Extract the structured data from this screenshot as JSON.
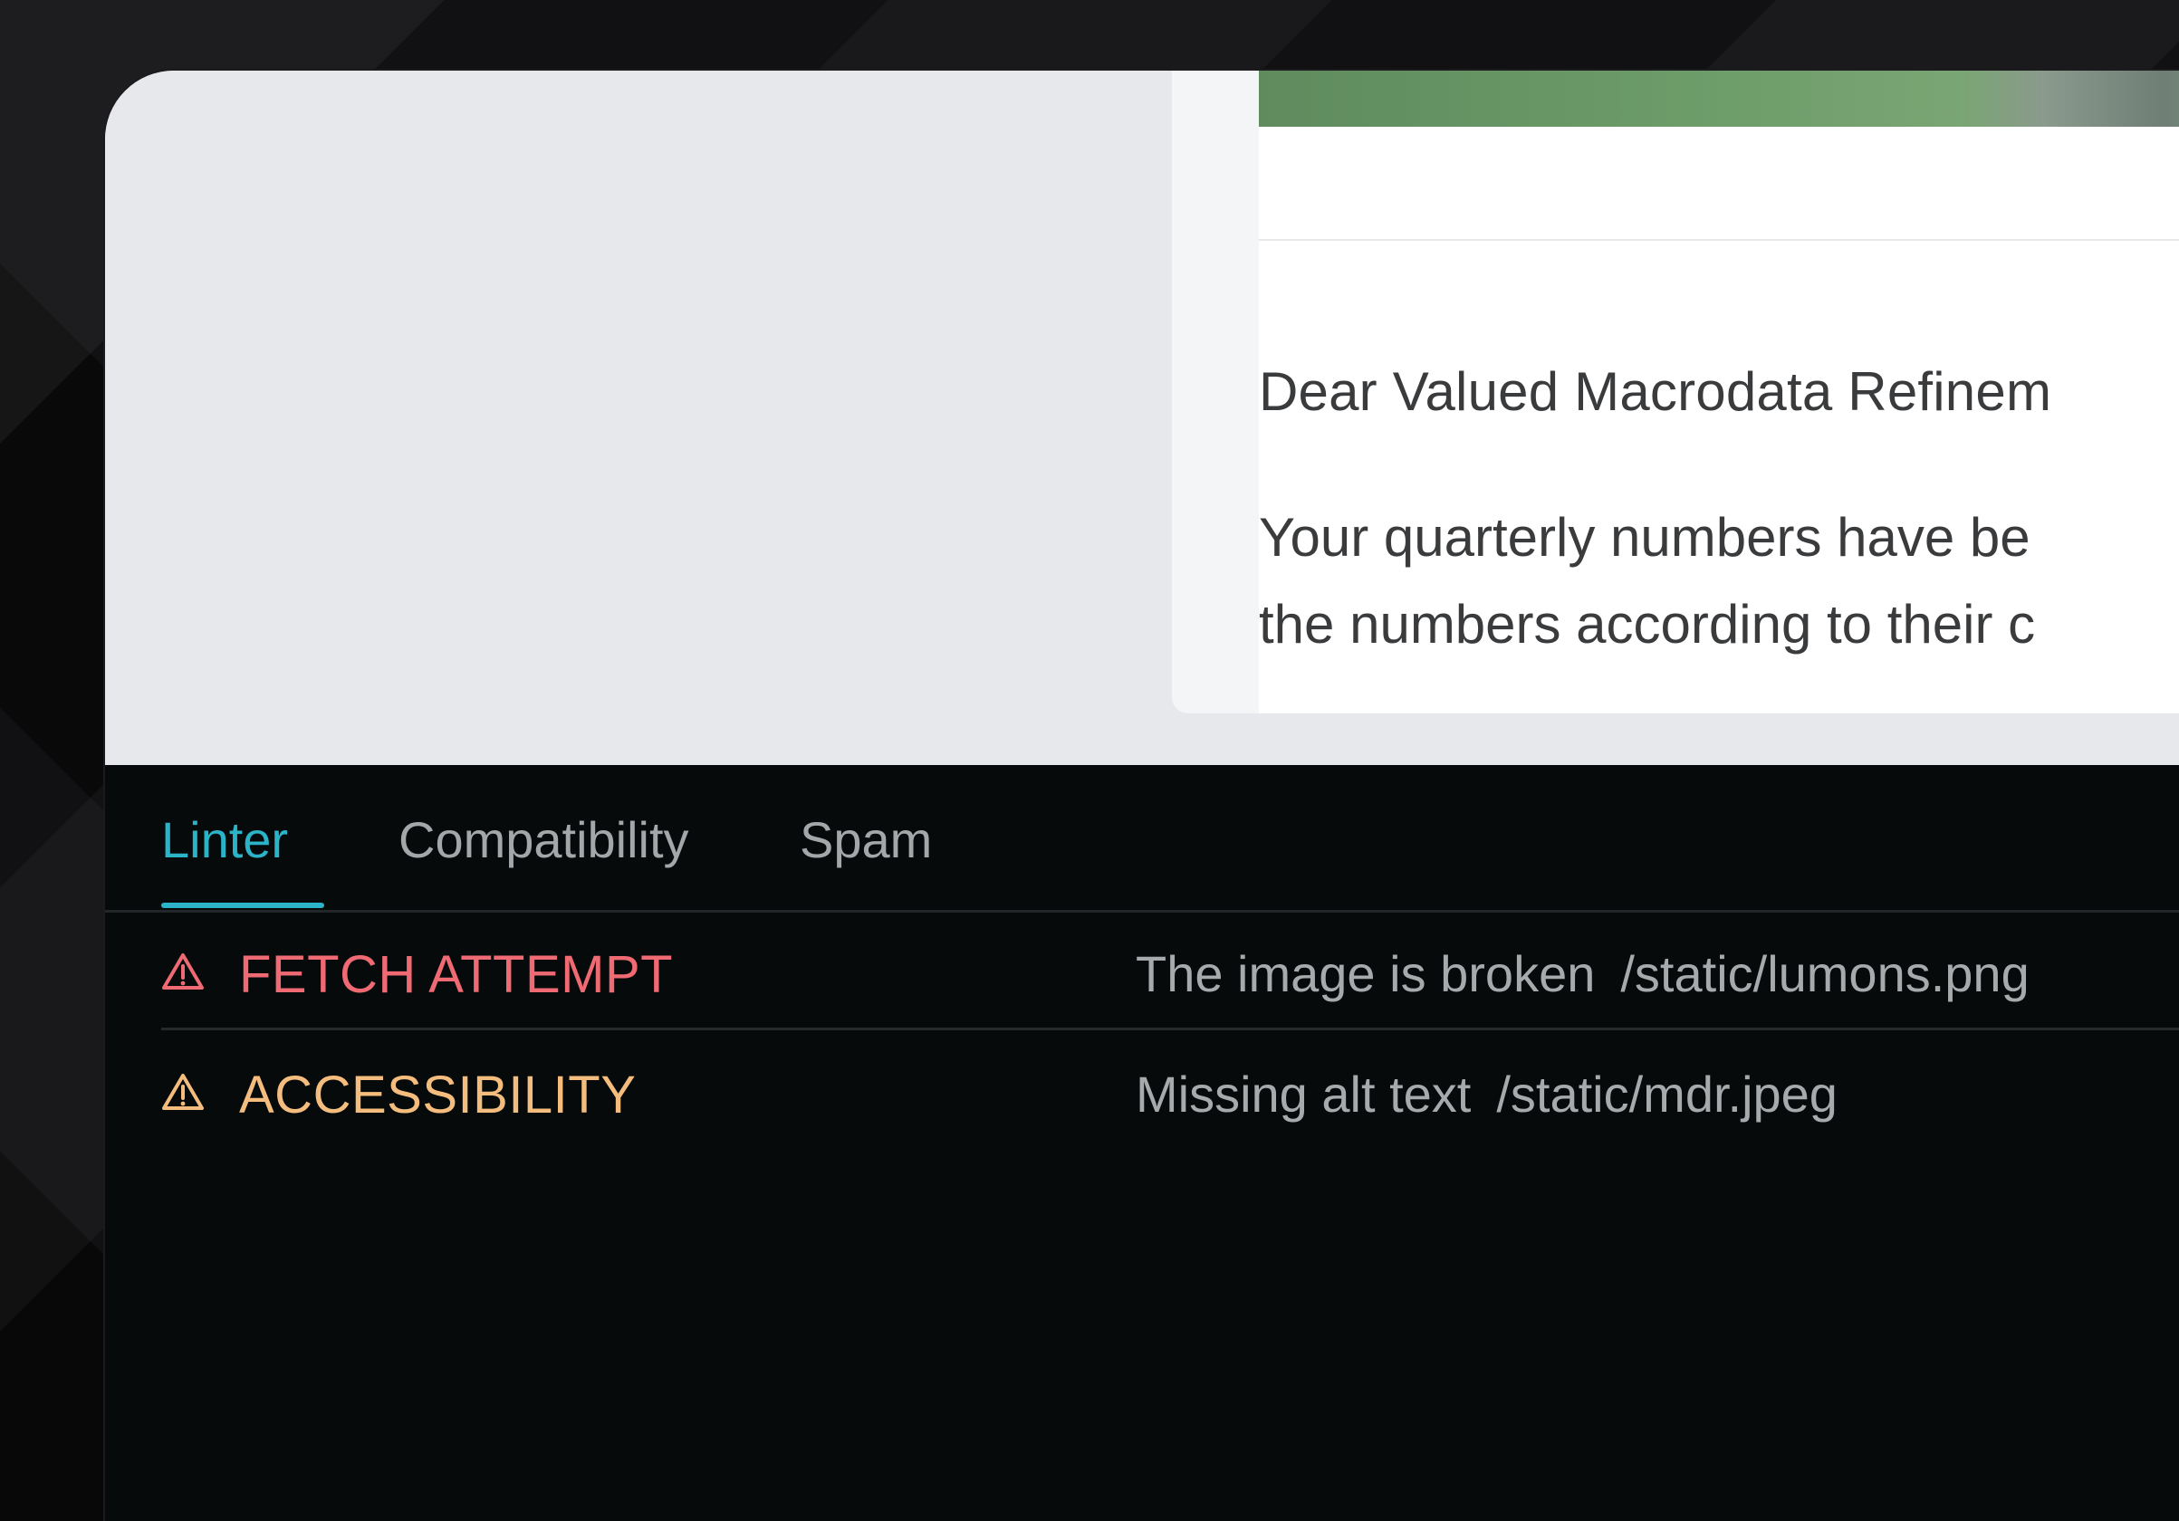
{
  "preview": {
    "greeting": "Dear Valued Macrodata Refinem",
    "paragraph_line1": "Your quarterly numbers have be",
    "paragraph_line2": "the numbers according to their c"
  },
  "panel": {
    "tabs": [
      {
        "label": "Linter",
        "active": true
      },
      {
        "label": "Compatibility",
        "active": false
      },
      {
        "label": "Spam",
        "active": false
      }
    ],
    "issues": [
      {
        "type": "FETCH ATTEMPT",
        "type_color": "#ef6a73",
        "description": "The image is broken",
        "path": "/static/lumons.png",
        "icon": "warning-triangle-icon"
      },
      {
        "type": "ACCESSIBILITY",
        "type_color": "#f4bd7e",
        "description": "Missing alt text",
        "path": "/static/mdr.jpeg",
        "icon": "warning-triangle-icon"
      }
    ]
  },
  "colors": {
    "accent": "#2bb3c7",
    "panel_bg": "#060a0b",
    "preview_bg": "#e6e8eb"
  }
}
